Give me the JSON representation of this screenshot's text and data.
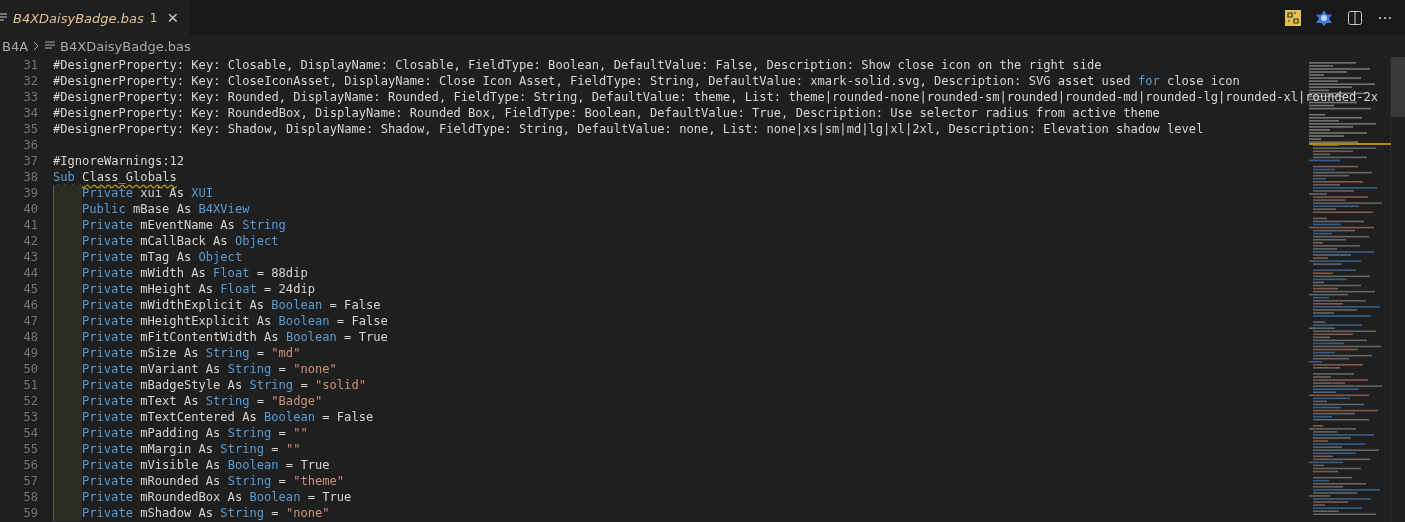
{
  "tab": {
    "title": "B4XDaisyBadge.bas",
    "problems": "1",
    "close": "×",
    "selected": true
  },
  "breadcrumb": [
    "B4A",
    "B4XDaisyBadge.bas"
  ],
  "lines": [
    {
      "number": "31",
      "tokens": [
        {
          "kind": "plain",
          "text": "#DesignerProperty: Key: Closable, DisplayName: Closable, FieldType: Boolean, DefaultValue: False, Description: Show close icon on the right side"
        }
      ]
    },
    {
      "number": "32",
      "tokens": [
        {
          "kind": "plain",
          "text": "#DesignerProperty: Key: CloseIconAsset, DisplayName: Close Icon Asset, FieldType: String, DefaultValue: xmark-solid.svg, Description: SVG asset used "
        },
        {
          "kind": "keyword",
          "text": "for"
        },
        {
          "kind": "plain",
          "text": " close icon"
        }
      ]
    },
    {
      "number": "33",
      "tokens": [
        {
          "kind": "plain",
          "text": "#DesignerProperty: Key: Rounded, DisplayName: Rounded, FieldType: String, DefaultValue: theme, List: theme|rounded-none|rounded-sm|rounded|rounded-md|rounded-lg|rounded-xl|rounded-2x"
        }
      ]
    },
    {
      "number": "34",
      "tokens": [
        {
          "kind": "plain",
          "text": "#DesignerProperty: Key: RoundedBox, DisplayName: Rounded Box, FieldType: Boolean, DefaultValue: True, Description: Use selector radius from active theme"
        }
      ]
    },
    {
      "number": "35",
      "tokens": [
        {
          "kind": "plain",
          "text": "#DesignerProperty: Key: Shadow, DisplayName: Shadow, FieldType: String, DefaultValue: none, List: none|xs|sm|md|lg|xl|2xl, Description: Elevation shadow level"
        }
      ]
    },
    {
      "number": "36"
    },
    {
      "number": "37",
      "tokens": [
        {
          "kind": "plain",
          "text": "#IgnoreWarnings:12"
        }
      ]
    },
    {
      "number": "38",
      "warning": true,
      "tokens": [
        {
          "kind": "keyword",
          "text": "Sub"
        },
        {
          "kind": "plain",
          "text": " Class_Globals"
        }
      ],
      "children": [
        {
          "number": "39",
          "tokens": [
            {
              "kind": "keyword",
              "text": "Private"
            },
            {
              "kind": "plain",
              "text": " xui As "
            },
            {
              "kind": "keyword",
              "text": "XUI"
            }
          ]
        },
        {
          "number": "40",
          "tokens": [
            {
              "kind": "keyword",
              "text": "Public"
            },
            {
              "kind": "plain",
              "text": " mBase As "
            },
            {
              "kind": "keyword",
              "text": "B4XView"
            }
          ]
        },
        {
          "number": "41",
          "tokens": [
            {
              "kind": "keyword",
              "text": "Private"
            },
            {
              "kind": "plain",
              "text": " mEventName As "
            },
            {
              "kind": "keyword",
              "text": "String"
            }
          ]
        },
        {
          "number": "42",
          "tokens": [
            {
              "kind": "keyword",
              "text": "Private"
            },
            {
              "kind": "plain",
              "text": " mCallBack As "
            },
            {
              "kind": "keyword",
              "text": "Object"
            }
          ]
        },
        {
          "number": "43",
          "tokens": [
            {
              "kind": "keyword",
              "text": "Private"
            },
            {
              "kind": "plain",
              "text": " mTag As "
            },
            {
              "kind": "keyword",
              "text": "Object"
            }
          ]
        },
        {
          "number": "44",
          "tokens": [
            {
              "kind": "keyword",
              "text": "Private"
            },
            {
              "kind": "plain",
              "text": " mWidth As "
            },
            {
              "kind": "keyword",
              "text": "Float"
            },
            {
              "kind": "plain",
              "text": " = 88dip"
            }
          ]
        },
        {
          "number": "45",
          "tokens": [
            {
              "kind": "keyword",
              "text": "Private"
            },
            {
              "kind": "plain",
              "text": " mHeight As "
            },
            {
              "kind": "keyword",
              "text": "Float"
            },
            {
              "kind": "plain",
              "text": " = 24dip"
            }
          ]
        },
        {
          "number": "46",
          "tokens": [
            {
              "kind": "keyword",
              "text": "Private"
            },
            {
              "kind": "plain",
              "text": " mWidthExplicit As "
            },
            {
              "kind": "keyword",
              "text": "Boolean"
            },
            {
              "kind": "plain",
              "text": " = False"
            }
          ]
        },
        {
          "number": "47",
          "tokens": [
            {
              "kind": "keyword",
              "text": "Private"
            },
            {
              "kind": "plain",
              "text": " mHeightExplicit As "
            },
            {
              "kind": "keyword",
              "text": "Boolean"
            },
            {
              "kind": "plain",
              "text": " = False"
            }
          ]
        },
        {
          "number": "48",
          "tokens": [
            {
              "kind": "keyword",
              "text": "Private"
            },
            {
              "kind": "plain",
              "text": " mFitContentWidth As "
            },
            {
              "kind": "keyword",
              "text": "Boolean"
            },
            {
              "kind": "plain",
              "text": " = True"
            }
          ]
        },
        {
          "number": "49",
          "tokens": [
            {
              "kind": "keyword",
              "text": "Private"
            },
            {
              "kind": "plain",
              "text": " mSize As "
            },
            {
              "kind": "keyword",
              "text": "String"
            },
            {
              "kind": "plain",
              "text": " = "
            },
            {
              "kind": "string",
              "text": "\"md\""
            }
          ]
        },
        {
          "number": "50",
          "tokens": [
            {
              "kind": "keyword",
              "text": "Private"
            },
            {
              "kind": "plain",
              "text": " mVariant As "
            },
            {
              "kind": "keyword",
              "text": "String"
            },
            {
              "kind": "plain",
              "text": " = "
            },
            {
              "kind": "string",
              "text": "\"none\""
            }
          ]
        },
        {
          "number": "51",
          "tokens": [
            {
              "kind": "keyword",
              "text": "Private"
            },
            {
              "kind": "plain",
              "text": " mBadgeStyle As "
            },
            {
              "kind": "keyword",
              "text": "String"
            },
            {
              "kind": "plain",
              "text": " = "
            },
            {
              "kind": "string",
              "text": "\"solid\""
            }
          ]
        },
        {
          "number": "52",
          "tokens": [
            {
              "kind": "keyword",
              "text": "Private"
            },
            {
              "kind": "plain",
              "text": " mText As "
            },
            {
              "kind": "keyword",
              "text": "String"
            },
            {
              "kind": "plain",
              "text": " = "
            },
            {
              "kind": "string",
              "text": "\"Badge\""
            }
          ]
        },
        {
          "number": "53",
          "tokens": [
            {
              "kind": "keyword",
              "text": "Private"
            },
            {
              "kind": "plain",
              "text": " mTextCentered As "
            },
            {
              "kind": "keyword",
              "text": "Boolean"
            },
            {
              "kind": "plain",
              "text": " = False"
            }
          ]
        },
        {
          "number": "54",
          "tokens": [
            {
              "kind": "keyword",
              "text": "Private"
            },
            {
              "kind": "plain",
              "text": " mPadding As "
            },
            {
              "kind": "keyword",
              "text": "String"
            },
            {
              "kind": "plain",
              "text": " = "
            },
            {
              "kind": "string",
              "text": "\"\""
            }
          ]
        },
        {
          "number": "55",
          "tokens": [
            {
              "kind": "keyword",
              "text": "Private"
            },
            {
              "kind": "plain",
              "text": " mMargin As "
            },
            {
              "kind": "keyword",
              "text": "String"
            },
            {
              "kind": "plain",
              "text": " = "
            },
            {
              "kind": "string",
              "text": "\"\""
            }
          ]
        },
        {
          "number": "56",
          "tokens": [
            {
              "kind": "keyword",
              "text": "Private"
            },
            {
              "kind": "plain",
              "text": " mVisible As "
            },
            {
              "kind": "keyword",
              "text": "Boolean"
            },
            {
              "kind": "plain",
              "text": " = True"
            }
          ]
        },
        {
          "number": "57",
          "tokens": [
            {
              "kind": "keyword",
              "text": "Private"
            },
            {
              "kind": "plain",
              "text": " mRounded As "
            },
            {
              "kind": "keyword",
              "text": "String"
            },
            {
              "kind": "plain",
              "text": " = "
            },
            {
              "kind": "string",
              "text": "\"theme\""
            }
          ]
        },
        {
          "number": "58",
          "tokens": [
            {
              "kind": "keyword",
              "text": "Private"
            },
            {
              "kind": "plain",
              "text": " mRoundedBox As "
            },
            {
              "kind": "keyword",
              "text": "Boolean"
            },
            {
              "kind": "plain",
              "text": " = True"
            }
          ]
        },
        {
          "number": "59",
          "tokens": [
            {
              "kind": "keyword",
              "text": "Private"
            },
            {
              "kind": "plain",
              "text": " mShadow As "
            },
            {
              "kind": "keyword",
              "text": "String"
            },
            {
              "kind": "plain",
              "text": " = "
            },
            {
              "kind": "string",
              "text": "\"none\""
            }
          ]
        }
      ]
    }
  ]
}
